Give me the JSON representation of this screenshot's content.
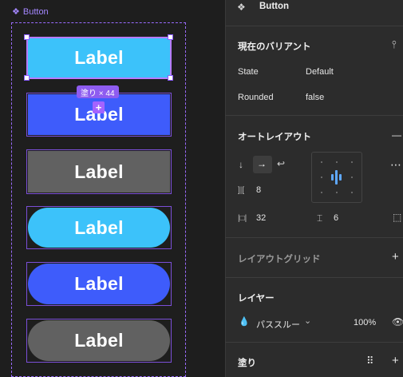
{
  "canvas": {
    "component_title": "Button",
    "fill_badge": "塗り × 44",
    "plus_badge": "+",
    "variants": [
      {
        "label": "Label",
        "color": "#3cc2fa",
        "shape": "square"
      },
      {
        "label": "Label",
        "color": "#3e5cfb",
        "shape": "square"
      },
      {
        "label": "Label",
        "color": "#616161",
        "shape": "square"
      },
      {
        "label": "Label",
        "color": "#3cc2fa",
        "shape": "rounded"
      },
      {
        "label": "Label",
        "color": "#3e5cfb",
        "shape": "rounded"
      },
      {
        "label": "Label",
        "color": "#616161",
        "shape": "rounded"
      }
    ]
  },
  "panel": {
    "header_title": "Button",
    "current_variant": {
      "title": "現在のバリアント",
      "props": [
        {
          "name": "State",
          "value": "Default"
        },
        {
          "name": "Rounded",
          "value": "false"
        }
      ]
    },
    "auto_layout": {
      "title": "オートレイアウト",
      "collapse": "—",
      "down_arrow": "↓",
      "right_arrow": "→",
      "wrap": "↩",
      "spacing_icon": "]|[",
      "spacing_value": "8",
      "padding_h_icon": "|□|",
      "padding_h_value": "32",
      "padding_v_icon": "⌶",
      "padding_v_value": "6",
      "more": "⋯"
    },
    "layout_grid": {
      "title": "レイアウトグリッド",
      "add": "+"
    },
    "layer": {
      "title": "レイヤー",
      "blend_mode": "パススルー",
      "caret": "⌄",
      "opacity": "100%"
    },
    "fill": {
      "title": "塗り",
      "add": "+",
      "styles": "⠿"
    }
  },
  "colors": {
    "canvas_bg": "#1e1e1e",
    "panel_bg": "#2c2c2c",
    "selection": "#9a6bff",
    "light_blue": "#3cc2fa",
    "blue": "#3e5cfb",
    "gray": "#616161"
  }
}
